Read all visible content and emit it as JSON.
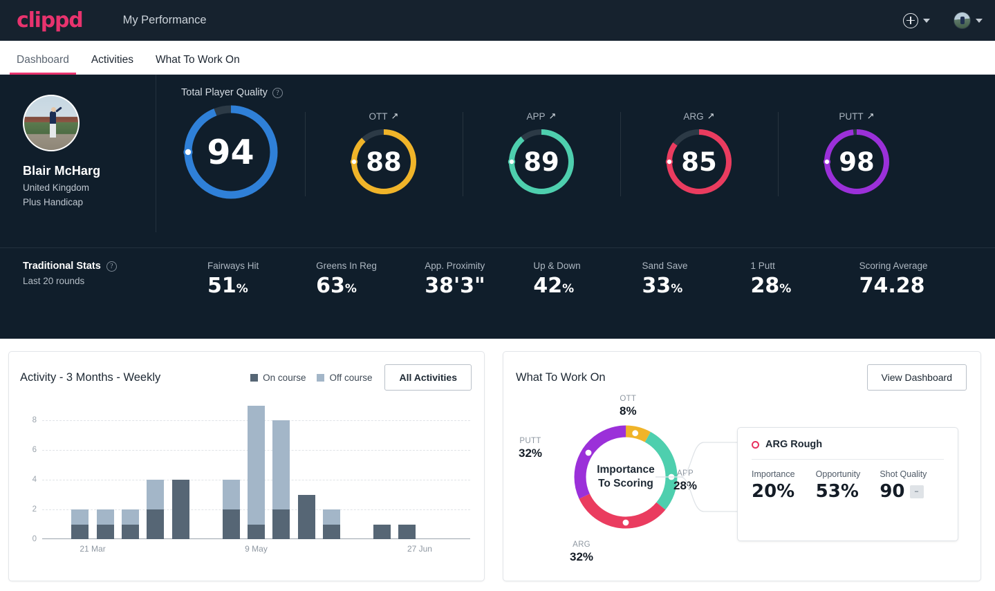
{
  "header": {
    "logo_text": "clippd",
    "app_title": "My Performance",
    "add_icon": "plus-circle-icon",
    "add_chevron_icon": "chevron-down-icon",
    "avatar_icon": "user-avatar",
    "avatar_chevron_icon": "chevron-down-icon"
  },
  "tabs": [
    {
      "label": "Dashboard",
      "active": true
    },
    {
      "label": "Activities",
      "active": false
    },
    {
      "label": "What To Work On",
      "active": false
    }
  ],
  "player": {
    "name": "Blair McHarg",
    "country": "United Kingdom",
    "handicap": "Plus Handicap"
  },
  "tpq": {
    "label": "Total Player Quality",
    "help_icon": "question-circle-icon",
    "main": {
      "label": "",
      "value": "94",
      "percent": 94,
      "color": "#2f80d8",
      "track": "#2c3a46"
    },
    "categories": [
      {
        "label": "OTT",
        "value": "88",
        "percent": 88,
        "color": "#f0b429",
        "trend_icon": "arrow-up-right-icon"
      },
      {
        "label": "APP",
        "value": "89",
        "percent": 89,
        "color": "#4ecfae",
        "trend_icon": "arrow-up-right-icon"
      },
      {
        "label": "ARG",
        "value": "85",
        "percent": 85,
        "color": "#ea3c5f",
        "trend_icon": "arrow-up-right-icon"
      },
      {
        "label": "PUTT",
        "value": "98",
        "percent": 98,
        "color": "#9b30d9",
        "trend_icon": "arrow-up-right-icon"
      }
    ]
  },
  "traditional": {
    "title": "Traditional Stats",
    "help_icon": "question-circle-icon",
    "subtitle": "Last 20 rounds",
    "stats": [
      {
        "label": "Fairways Hit",
        "value": "51",
        "unit": "%"
      },
      {
        "label": "Greens In Reg",
        "value": "63",
        "unit": "%"
      },
      {
        "label": "App. Proximity",
        "value": "38'3\"",
        "unit": ""
      },
      {
        "label": "Up & Down",
        "value": "42",
        "unit": "%"
      },
      {
        "label": "Sand Save",
        "value": "33",
        "unit": "%"
      },
      {
        "label": "1 Putt",
        "value": "28",
        "unit": "%"
      },
      {
        "label": "Scoring Average",
        "value": "74.28",
        "unit": ""
      }
    ]
  },
  "activity_card": {
    "title": "Activity - 3 Months - Weekly",
    "legend": [
      {
        "label": "On course",
        "color": "#566675"
      },
      {
        "label": "Off course",
        "color": "#a3b6c8"
      }
    ],
    "button": "All Activities"
  },
  "work_card": {
    "title": "What To Work On",
    "button": "View Dashboard",
    "center_line1": "Importance",
    "center_line2": "To Scoring",
    "detail": {
      "marker_icon": "ring-dot-icon",
      "title": "ARG Rough",
      "marker_color": "#e8325f",
      "metrics": [
        {
          "label": "Importance",
          "value": "20%"
        },
        {
          "label": "Opportunity",
          "value": "53%"
        },
        {
          "label": "Shot Quality",
          "value": "90",
          "badge": "–"
        }
      ]
    }
  },
  "chart_data": [
    {
      "type": "bar",
      "title": "Activity - 3 Months - Weekly",
      "stacked": true,
      "xlabel": "",
      "ylabel": "",
      "ylim": [
        0,
        9
      ],
      "yticks": [
        0,
        2,
        4,
        6,
        8
      ],
      "grid": true,
      "legend_position": "top-right",
      "categories": [
        "",
        "21 Mar",
        "",
        "",
        "",
        "",
        "",
        "",
        "9 May",
        "",
        "",
        "",
        "",
        "",
        "",
        "27 Jun",
        ""
      ],
      "tick_labels": [
        {
          "index": 1,
          "label": "21 Mar"
        },
        {
          "index": 8,
          "label": "9 May"
        },
        {
          "index": 15,
          "label": "27 Jun"
        }
      ],
      "series": [
        {
          "name": "On course",
          "color": "#566675",
          "values": [
            0,
            1,
            1,
            1,
            2,
            4,
            0,
            2,
            1,
            2,
            3,
            1,
            0,
            1,
            1,
            0,
            0
          ]
        },
        {
          "name": "Off course",
          "color": "#a3b6c8",
          "values": [
            0,
            1,
            1,
            1,
            2,
            0,
            0,
            2,
            8,
            6,
            0,
            1,
            0,
            0,
            0,
            0,
            0
          ]
        }
      ]
    },
    {
      "type": "pie",
      "title": "Importance To Scoring",
      "labels": [
        "OTT",
        "APP",
        "ARG",
        "PUTT"
      ],
      "values": [
        8,
        28,
        32,
        32
      ],
      "value_labels": [
        "8%",
        "28%",
        "32%",
        "32%"
      ],
      "colors": [
        "#f0b429",
        "#4ecfae",
        "#ea3c5f",
        "#9b30d9"
      ],
      "legend_position": "around"
    }
  ]
}
